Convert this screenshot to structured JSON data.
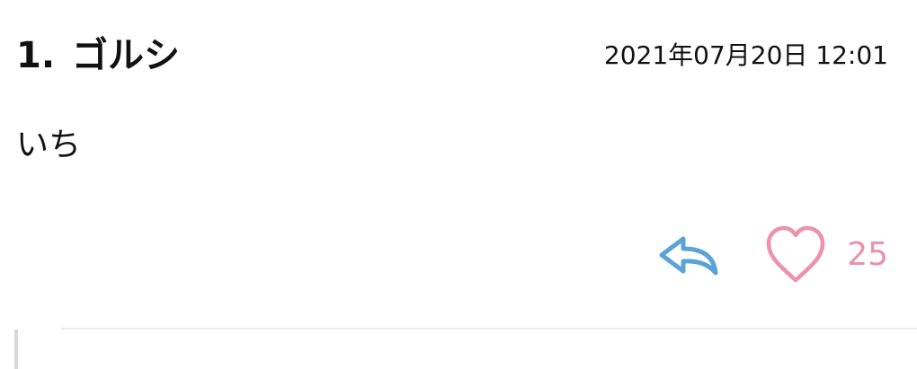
{
  "comment": {
    "number": "1.",
    "author": "ゴルシ",
    "timestamp": "2021年07月20日 12:01",
    "body": "いち",
    "likes": "25"
  },
  "icons": {
    "reply": "reply-arrow-icon",
    "like": "heart-outline-icon"
  },
  "colors": {
    "reply_icon": "#5aa2d8",
    "like_accent": "#ee91ac",
    "text": "#111111",
    "divider": "#ececec"
  }
}
